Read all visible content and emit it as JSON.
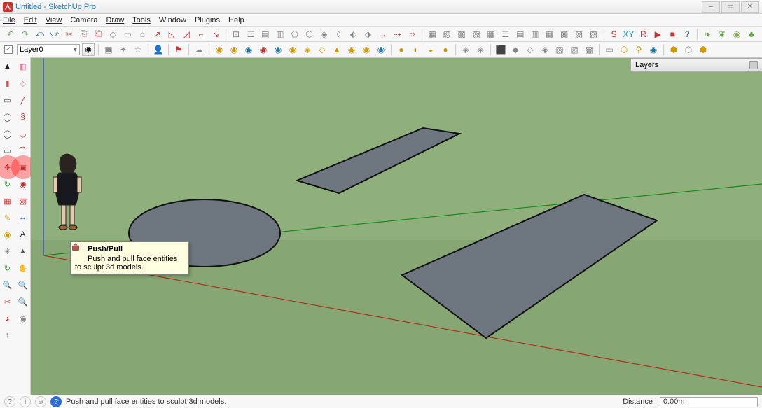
{
  "window": {
    "title": "Untitled - SketchUp Pro",
    "controls": {
      "min": "–",
      "max": "▭",
      "close": "✕"
    }
  },
  "menu": {
    "items": [
      "File",
      "Edit",
      "View",
      "Camera",
      "Draw",
      "Tools",
      "Window",
      "Plugins",
      "Help"
    ]
  },
  "toolbar_row2": {
    "checkmark": "✓",
    "layer_label": "Layer0"
  },
  "tooltip": {
    "title": "Push/Pull",
    "body": "Push and pull face entities to sculpt 3d models."
  },
  "layers_panel": {
    "title": "Layers"
  },
  "statusbar": {
    "hint": "Push and pull face entities to sculpt 3d models.",
    "distance_label": "Distance",
    "distance_value": "0.00m"
  },
  "left_tools": [
    {
      "n": "select-tool",
      "g": "▲",
      "c": "#222"
    },
    {
      "n": "eraser-tool",
      "g": "◧",
      "c": "#e79"
    },
    {
      "n": "paint-bucket-tool",
      "g": "▮",
      "c": "#b66"
    },
    {
      "n": "eraser2-tool",
      "g": "◇",
      "c": "#d77"
    },
    {
      "n": "rectangle-tool",
      "g": "▭",
      "c": "#555"
    },
    {
      "n": "line-tool",
      "g": "╱",
      "c": "#c33"
    },
    {
      "n": "circle-tool",
      "g": "◯",
      "c": "#555"
    },
    {
      "n": "freehand-tool",
      "g": "§",
      "c": "#c33"
    },
    {
      "n": "polygon-tool",
      "g": "◯",
      "c": "#555"
    },
    {
      "n": "arc-tool",
      "g": "◡",
      "c": "#c33"
    },
    {
      "n": "offset-tool",
      "g": "▭",
      "c": "#555"
    },
    {
      "n": "arc2-tool",
      "g": "⌒",
      "c": "#c33"
    },
    {
      "n": "move-tool",
      "g": "✥",
      "c": "#c33",
      "hl": true
    },
    {
      "n": "pushpull-tool",
      "g": "▣",
      "c": "#b33",
      "hl": true
    },
    {
      "n": "rotate-tool",
      "g": "↻",
      "c": "#2a2"
    },
    {
      "n": "followme-tool",
      "g": "◉",
      "c": "#b33"
    },
    {
      "n": "scale-tool",
      "g": "▦",
      "c": "#c33"
    },
    {
      "n": "offset2-tool",
      "g": "▧",
      "c": "#c33"
    },
    {
      "n": "tape-tool",
      "g": "✎",
      "c": "#c90"
    },
    {
      "n": "dimension-tool",
      "g": "↔",
      "c": "#279"
    },
    {
      "n": "protractor-tool",
      "g": "◉",
      "c": "#c90"
    },
    {
      "n": "text-tool",
      "g": "A",
      "c": "#333"
    },
    {
      "n": "axes-tool",
      "g": "✳",
      "c": "#666"
    },
    {
      "n": "3dtext-tool",
      "g": "▲",
      "c": "#555"
    },
    {
      "n": "orbit-tool",
      "g": "↻",
      "c": "#2a2"
    },
    {
      "n": "pan-tool",
      "g": "✋",
      "c": "#2a2"
    },
    {
      "n": "zoom-tool",
      "g": "🔍",
      "c": "#279"
    },
    {
      "n": "zoomwin-tool",
      "g": "🔍",
      "c": "#279"
    },
    {
      "n": "zoomext-tool",
      "g": "✂",
      "c": "#c33"
    },
    {
      "n": "prev-tool",
      "g": "🔍",
      "c": "#279"
    },
    {
      "n": "walk-tool",
      "g": "⇣",
      "c": "#c33"
    },
    {
      "n": "look-tool",
      "g": "◉",
      "c": "#888"
    },
    {
      "n": "section-tool",
      "g": "↕",
      "c": "#888"
    },
    {
      "n": "blank-tool",
      "g": "",
      "c": "#888"
    }
  ],
  "top_tools_row1": [
    {
      "n": "new-icon",
      "g": "↶",
      "c": "#7a7"
    },
    {
      "n": "open-icon",
      "g": "↷",
      "c": "#7a7"
    },
    {
      "n": "undo-icon",
      "g": "⤺",
      "c": "#279"
    },
    {
      "n": "redo-icon",
      "g": "⤻",
      "c": "#279"
    },
    {
      "n": "cut-icon",
      "g": "✂",
      "c": "#c55"
    },
    {
      "n": "copy-icon",
      "g": "⎘",
      "c": "#c55"
    },
    {
      "n": "paste-icon",
      "g": "⎗",
      "c": "#c55"
    },
    {
      "n": "tool-a",
      "g": "◇",
      "c": "#888"
    },
    {
      "n": "tool-b",
      "g": "▭",
      "c": "#888"
    },
    {
      "n": "tool-c",
      "g": "⌂",
      "c": "#888"
    },
    {
      "n": "tool-d",
      "g": "↗",
      "c": "#c33"
    },
    {
      "n": "tool-e",
      "g": "◺",
      "c": "#c33"
    },
    {
      "n": "tool-f",
      "g": "◿",
      "c": "#c33"
    },
    {
      "n": "tool-g",
      "g": "⌐",
      "c": "#c33"
    },
    {
      "n": "tool-h",
      "g": "↘",
      "c": "#c33"
    },
    {
      "n": "sep"
    },
    {
      "n": "tool-i",
      "g": "⊡",
      "c": "#888"
    },
    {
      "n": "tool-j",
      "g": "☲",
      "c": "#888"
    },
    {
      "n": "tool-k",
      "g": "▤",
      "c": "#888"
    },
    {
      "n": "tool-l",
      "g": "▥",
      "c": "#888"
    },
    {
      "n": "tool-m",
      "g": "⬠",
      "c": "#888"
    },
    {
      "n": "tool-n",
      "g": "⬡",
      "c": "#888"
    },
    {
      "n": "tool-o",
      "g": "◈",
      "c": "#888"
    },
    {
      "n": "tool-p",
      "g": "◊",
      "c": "#888"
    },
    {
      "n": "tool-q",
      "g": "⬖",
      "c": "#888"
    },
    {
      "n": "tool-r",
      "g": "⬗",
      "c": "#888"
    },
    {
      "n": "tool-s",
      "g": "→",
      "c": "#c33"
    },
    {
      "n": "tool-t",
      "g": "⇢",
      "c": "#c33"
    },
    {
      "n": "tool-u",
      "g": "⤳",
      "c": "#c33"
    },
    {
      "n": "sep"
    },
    {
      "n": "tool-v",
      "g": "▦",
      "c": "#888"
    },
    {
      "n": "tool-w",
      "g": "▨",
      "c": "#888"
    },
    {
      "n": "tool-x",
      "g": "▩",
      "c": "#888"
    },
    {
      "n": "tool-y",
      "g": "▧",
      "c": "#888"
    },
    {
      "n": "tool-z",
      "g": "▦",
      "c": "#888"
    },
    {
      "n": "tool-aa",
      "g": "☰",
      "c": "#888"
    },
    {
      "n": "tool-ab",
      "g": "▤",
      "c": "#888"
    },
    {
      "n": "tool-ac",
      "g": "▥",
      "c": "#888"
    },
    {
      "n": "tool-ad",
      "g": "▦",
      "c": "#888"
    },
    {
      "n": "tool-ae",
      "g": "▩",
      "c": "#888"
    },
    {
      "n": "tool-af",
      "g": "▨",
      "c": "#888"
    },
    {
      "n": "tool-ag",
      "g": "▧",
      "c": "#888"
    },
    {
      "n": "sep"
    },
    {
      "n": "skin-icon",
      "g": "S",
      "c": "#c33"
    },
    {
      "n": "xy-icon",
      "g": "XY",
      "c": "#29c"
    },
    {
      "n": "rub-icon",
      "g": "R",
      "c": "#c33"
    },
    {
      "n": "play-icon",
      "g": "▶",
      "c": "#c33"
    },
    {
      "n": "stop-icon",
      "g": "■",
      "c": "#c33"
    },
    {
      "n": "help-icon",
      "g": "?",
      "c": "#279"
    },
    {
      "n": "sep"
    },
    {
      "n": "leaf-icon",
      "g": "❧",
      "c": "#5a3"
    },
    {
      "n": "grass-icon",
      "g": "❦",
      "c": "#5a3"
    },
    {
      "n": "rock-icon",
      "g": "◉",
      "c": "#8a5"
    },
    {
      "n": "tree-icon",
      "g": "♣",
      "c": "#5a3"
    }
  ],
  "top_tools_row2_right": [
    {
      "n": "globe-icon",
      "g": "◉",
      "c": "#c90"
    },
    {
      "n": "globe2-icon",
      "g": "◉",
      "c": "#c90"
    },
    {
      "n": "globe3-icon",
      "g": "◉",
      "c": "#279"
    },
    {
      "n": "globe4-icon",
      "g": "◉",
      "c": "#c33"
    },
    {
      "n": "globe5-icon",
      "g": "◉",
      "c": "#279"
    },
    {
      "n": "globe6-icon",
      "g": "◉",
      "c": "#c90"
    },
    {
      "n": "globe7-icon",
      "g": "◈",
      "c": "#c90"
    },
    {
      "n": "globe8-icon",
      "g": "◇",
      "c": "#c90"
    },
    {
      "n": "globe9-icon",
      "g": "▲",
      "c": "#c90"
    },
    {
      "n": "globe10-icon",
      "g": "◉",
      "c": "#c90"
    },
    {
      "n": "globe11-icon",
      "g": "◉",
      "c": "#c90"
    },
    {
      "n": "globe12-icon",
      "g": "◉",
      "c": "#279"
    },
    {
      "n": "sep"
    },
    {
      "n": "sphere1-icon",
      "g": "●",
      "c": "#c90"
    },
    {
      "n": "sphere2-icon",
      "g": "◐",
      "c": "#c90"
    },
    {
      "n": "sphere3-icon",
      "g": "◒",
      "c": "#c90"
    },
    {
      "n": "sphere4-icon",
      "g": "●",
      "c": "#c90"
    },
    {
      "n": "sep"
    },
    {
      "n": "layer1-icon",
      "g": "◈",
      "c": "#888"
    },
    {
      "n": "layer2-icon",
      "g": "◈",
      "c": "#888"
    },
    {
      "n": "sep"
    },
    {
      "n": "paint1-icon",
      "g": "⬛",
      "c": "#c33"
    },
    {
      "n": "paint2-icon",
      "g": "◆",
      "c": "#888"
    },
    {
      "n": "paint3-icon",
      "g": "◇",
      "c": "#888"
    },
    {
      "n": "paint4-icon",
      "g": "◈",
      "c": "#888"
    },
    {
      "n": "paint5-icon",
      "g": "▧",
      "c": "#888"
    },
    {
      "n": "paint6-icon",
      "g": "▨",
      "c": "#888"
    },
    {
      "n": "paint7-icon",
      "g": "▩",
      "c": "#888"
    },
    {
      "n": "sep"
    },
    {
      "n": "map1-icon",
      "g": "▭",
      "c": "#888"
    },
    {
      "n": "map2-icon",
      "g": "⬡",
      "c": "#c90"
    },
    {
      "n": "map3-icon",
      "g": "⚲",
      "c": "#c90"
    },
    {
      "n": "map4-icon",
      "g": "◉",
      "c": "#279"
    },
    {
      "n": "sep"
    },
    {
      "n": "cube1-icon",
      "g": "⬢",
      "c": "#c90"
    },
    {
      "n": "cube2-icon",
      "g": "⬡",
      "c": "#888"
    },
    {
      "n": "cube3-icon",
      "g": "⬢",
      "c": "#c90"
    }
  ],
  "top_tools_row2_left": [
    {
      "n": "comp1-icon",
      "g": "▣",
      "c": "#888"
    },
    {
      "n": "comp2-icon",
      "g": "✦",
      "c": "#888"
    },
    {
      "n": "comp3-icon",
      "g": "☆",
      "c": "#888"
    },
    {
      "n": "sep"
    },
    {
      "n": "person-icon",
      "g": "👤",
      "c": "#c33"
    },
    {
      "n": "sep"
    },
    {
      "n": "tag-icon",
      "g": "⚑",
      "c": "#c33"
    },
    {
      "n": "sep"
    },
    {
      "n": "cloud-icon",
      "g": "☁",
      "c": "#888"
    }
  ]
}
